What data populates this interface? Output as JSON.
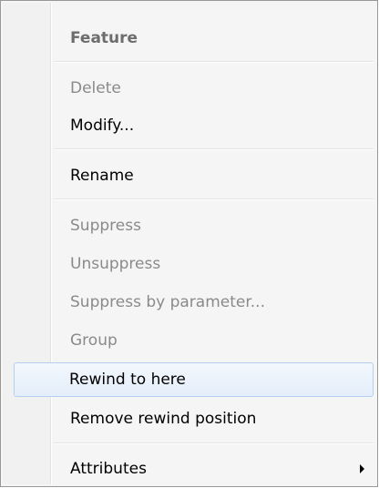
{
  "menu": {
    "header": "Feature",
    "items": [
      {
        "label": "Delete",
        "enabled": false
      },
      {
        "label": "Modify...",
        "enabled": true
      },
      {
        "label": "Rename",
        "enabled": true
      },
      {
        "label": "Suppress",
        "enabled": false
      },
      {
        "label": "Unsuppress",
        "enabled": false
      },
      {
        "label": "Suppress by parameter...",
        "enabled": false
      },
      {
        "label": "Group",
        "enabled": false
      },
      {
        "label": "Rewind to here",
        "enabled": true,
        "highlighted": true
      },
      {
        "label": "Remove rewind position",
        "enabled": true
      },
      {
        "label": "Attributes",
        "enabled": true,
        "submenu": true,
        "icon": "submenu-arrow-icon"
      }
    ]
  }
}
